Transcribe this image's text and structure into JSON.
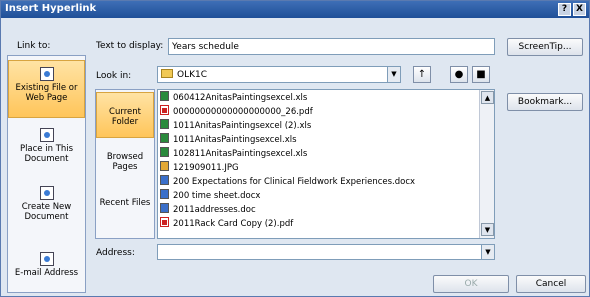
{
  "window": {
    "title": "Insert Hyperlink",
    "help_label": "?",
    "close_label": "X"
  },
  "link_to": {
    "label": "Link to:",
    "items": [
      {
        "label": "Existing File or Web Page",
        "icon": "existing-file-icon",
        "active": true
      },
      {
        "label": "Place in This Document",
        "icon": "place-in-document-icon",
        "active": false
      },
      {
        "label": "Create New Document",
        "icon": "create-new-document-icon",
        "active": false
      },
      {
        "label": "E-mail Address",
        "icon": "email-address-icon",
        "active": false
      }
    ]
  },
  "text_to_display": {
    "label": "Text to display:",
    "value": "Years schedule"
  },
  "screentip_button": "ScreenTip...",
  "look_in": {
    "label": "Look in:",
    "value": "OLK1C"
  },
  "toolbar_icons": [
    "up-folder-icon",
    "search-web-icon",
    "recent-folder-icon"
  ],
  "side_nav": [
    {
      "label": "Current Folder",
      "active": true
    },
    {
      "label": "Browsed Pages",
      "active": false
    },
    {
      "label": "Recent Files",
      "active": false
    }
  ],
  "files": [
    {
      "name": "060412AnitasPaintingsexcel.xls",
      "type": "xls"
    },
    {
      "name": "00000000000000000000_26.pdf",
      "type": "pdf"
    },
    {
      "name": "1011AnitasPaintingsexcel (2).xls",
      "type": "xls"
    },
    {
      "name": "1011AnitasPaintingsexcel.xls",
      "type": "xls"
    },
    {
      "name": "102811AnitasPaintingsexcel.xls",
      "type": "xls"
    },
    {
      "name": "121909011.JPG",
      "type": "jpg"
    },
    {
      "name": "200 Expectations for Clinical Fieldwork Experiences.docx",
      "type": "doc"
    },
    {
      "name": "200 time sheet.docx",
      "type": "doc"
    },
    {
      "name": "2011addresses.doc",
      "type": "doc"
    },
    {
      "name": "2011Rack Card Copy (2).pdf",
      "type": "pdf"
    }
  ],
  "bookmark_button": "Bookmark...",
  "address": {
    "label": "Address:",
    "value": ""
  },
  "ok_button": "OK",
  "cancel_button": "Cancel"
}
